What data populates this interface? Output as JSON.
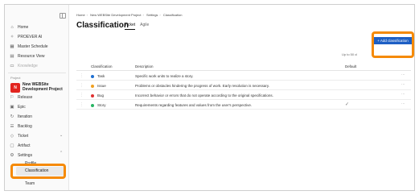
{
  "sidebar": {
    "items": [
      {
        "label": "Home",
        "icon": "home-icon",
        "glyph": "⌂"
      },
      {
        "label": "PROEVER AI",
        "icon": "sparkle-icon",
        "glyph": "✧"
      },
      {
        "label": "Master Schedule",
        "icon": "calendar-icon",
        "glyph": "▦"
      },
      {
        "label": "Resource View",
        "icon": "resource-icon",
        "glyph": "▤"
      },
      {
        "label": "Knowledge",
        "icon": "book-icon",
        "glyph": "▭"
      }
    ],
    "project_section_label": "Project",
    "project_name": "New WEBSite Development Project",
    "project_logo_text": "N",
    "project_items": [
      {
        "label": "Release",
        "icon": "release-icon",
        "glyph": "⚐"
      },
      {
        "label": "Epic",
        "icon": "epic-icon",
        "glyph": "▣"
      },
      {
        "label": "Iteration",
        "icon": "iteration-icon",
        "glyph": "↻"
      },
      {
        "label": "Backlog",
        "icon": "backlog-icon",
        "glyph": "☰"
      },
      {
        "label": "Ticket",
        "icon": "ticket-icon",
        "glyph": "◇"
      },
      {
        "label": "Artifact",
        "icon": "artifact-icon",
        "glyph": "▢"
      },
      {
        "label": "Settings",
        "icon": "gear-icon",
        "glyph": "⚙"
      }
    ],
    "settings_sub_items": [
      "Profile",
      "Classification",
      "Team"
    ]
  },
  "breadcrumb": [
    "Home",
    "New WEBSite Development Project",
    "Settings",
    "Classification"
  ],
  "page_title": "Classification",
  "tabs": [
    "Ticket",
    "Agile"
  ],
  "add_button_label": "+ Add classification",
  "upto_text": "Up to 50 cl",
  "table": {
    "headers": [
      "Classification",
      "Description",
      "Default"
    ],
    "rows": [
      {
        "name": "Task",
        "color": "#1f6fd1",
        "description": "Specific work units to realize a story.",
        "default": false
      },
      {
        "name": "Issue",
        "color": "#f0a020",
        "description": "Problems or obstacles hindering the progress of work. Early resolution is necessary.",
        "default": false
      },
      {
        "name": "Bug",
        "color": "#e03030",
        "description": "Incorrect behavior or errors that do not operate according to the original specifications.",
        "default": false
      },
      {
        "name": "Story",
        "color": "#28b463",
        "description": "Requirements regarding features and values from the user's perspective.",
        "default": true
      }
    ]
  },
  "highlight_color": "#f58a07"
}
